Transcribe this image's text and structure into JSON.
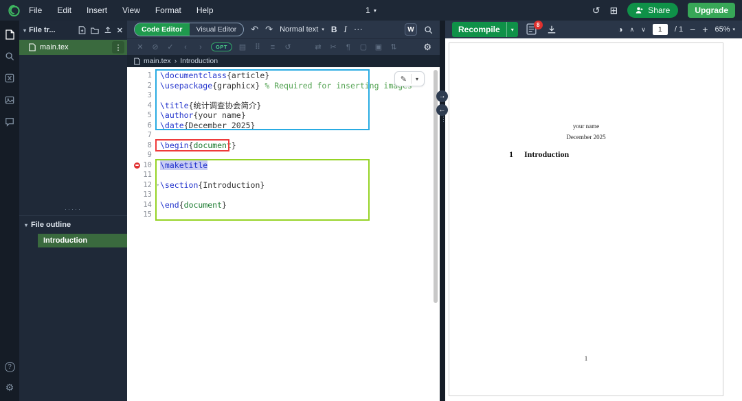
{
  "menubar": {
    "menus": [
      "File",
      "Edit",
      "Insert",
      "View",
      "Format",
      "Help"
    ],
    "center_label": "1",
    "share_label": "Share",
    "upgrade_label": "Upgrade"
  },
  "filetree": {
    "header": "File tr...",
    "file_name": "main.tex",
    "outline_header": "File outline",
    "outline_item": "Introduction"
  },
  "toolbar": {
    "code_editor_label": "Code Editor",
    "visual_editor_label": "Visual Editor",
    "undo_glyph": "↶",
    "redo_glyph": "↷",
    "format_label": "Normal text",
    "bold_label": "B",
    "italic_label": "I",
    "more_label": "⋯",
    "writefull_label": "W"
  },
  "toolbar2": {
    "gpt_label": "GPT",
    "group1": [
      [
        "close",
        "✕"
      ],
      [
        "block",
        "⊘"
      ],
      [
        "accept",
        "✓"
      ],
      [
        "prev",
        "‹"
      ],
      [
        "next",
        "›"
      ]
    ],
    "group2": [
      [
        "table",
        "▤"
      ],
      [
        "grid",
        "⠿"
      ],
      [
        "list",
        "≡"
      ],
      [
        "history",
        "↺"
      ]
    ],
    "group3": [
      [
        "swap",
        "⇄"
      ],
      [
        "cut",
        "✂"
      ],
      [
        "paragraph",
        "¶"
      ],
      [
        "box-empty",
        "▢"
      ],
      [
        "box-filled",
        "▣"
      ],
      [
        "reorder",
        "⇅"
      ]
    ],
    "settings_glyph": "⚙"
  },
  "breadcrumb": {
    "file": "main.tex",
    "sep": "›",
    "section": "Introduction"
  },
  "code": {
    "lines": [
      {
        "n": 1,
        "segs": [
          [
            "cmd",
            "\\documentclass"
          ],
          [
            "txt",
            "{article}"
          ]
        ]
      },
      {
        "n": 2,
        "segs": [
          [
            "cmd",
            "\\usepackage"
          ],
          [
            "txt",
            "{graphicx}"
          ],
          [
            "com",
            " % Required for inserting images"
          ]
        ]
      },
      {
        "n": 3,
        "segs": []
      },
      {
        "n": 4,
        "segs": [
          [
            "cmd",
            "\\title"
          ],
          [
            "txt",
            "{统计调查协会简介}"
          ]
        ]
      },
      {
        "n": 5,
        "segs": [
          [
            "cmd",
            "\\author"
          ],
          [
            "txt",
            "{your name}"
          ]
        ]
      },
      {
        "n": 6,
        "segs": [
          [
            "cmd",
            "\\date"
          ],
          [
            "txt",
            "{December 2025}"
          ]
        ]
      },
      {
        "n": 7,
        "segs": []
      },
      {
        "n": 8,
        "segs": [
          [
            "cmd",
            "\\begin"
          ],
          [
            "txt",
            "{"
          ],
          [
            "env",
            "document"
          ],
          [
            "txt",
            "}"
          ]
        ]
      },
      {
        "n": 9,
        "segs": []
      },
      {
        "n": 10,
        "segs": [
          [
            "cmd sel",
            "\\maketitle"
          ]
        ],
        "marker": "error"
      },
      {
        "n": 11,
        "segs": []
      },
      {
        "n": 12,
        "segs": [
          [
            "cmd",
            "\\section"
          ],
          [
            "txt",
            "{Introduction}"
          ]
        ],
        "fold": true
      },
      {
        "n": 13,
        "segs": []
      },
      {
        "n": 14,
        "segs": [
          [
            "cmd",
            "\\end"
          ],
          [
            "txt",
            "{"
          ],
          [
            "env",
            "document"
          ],
          [
            "txt",
            "}"
          ]
        ]
      },
      {
        "n": 15,
        "segs": []
      }
    ]
  },
  "pdfbar": {
    "recompile_label": "Recompile",
    "error_count": "8",
    "page_value": "1",
    "page_total": "/ 1",
    "zoom_label": "65%"
  },
  "pdf": {
    "author": "your name",
    "date": "December 2025",
    "section_number": "1",
    "section_title": "Introduction",
    "page_number": "1"
  }
}
